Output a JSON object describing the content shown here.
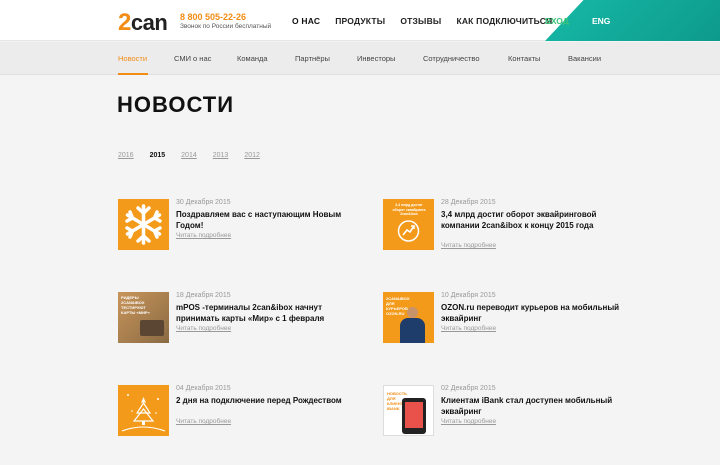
{
  "header": {
    "logo": {
      "two": "2",
      "can": "can"
    },
    "phone": "8 800 505-22-26",
    "phone_sub": "Звонок по России бесплатный",
    "nav": [
      "О НАС",
      "ПРОДУКТЫ",
      "ОТЗЫВЫ",
      "КАК ПОДКЛЮЧИТЬСЯ"
    ],
    "login": "ВХОД",
    "lang": "ENG"
  },
  "subnav": [
    "Новости",
    "СМИ о нас",
    "Команда",
    "Партнёры",
    "Инвесторы",
    "Сотрудничество",
    "Контакты",
    "Вакансии"
  ],
  "page_title": "НОВОСТИ",
  "years": [
    "2016",
    "2015",
    "2014",
    "2013",
    "2012"
  ],
  "read_more": "Читать подробнее",
  "news": [
    {
      "date": "30 Декабря 2015",
      "title": "Поздравляем вас с наступающим Новым Годом!",
      "thumb": "snowflake-icon"
    },
    {
      "date": "28 Декабря 2015",
      "title": "3,4 млрд достиг оборот эквайринговой компании 2can&ibox к концу 2015 года",
      "thumb": "growth-chart-icon",
      "thumb_text": "3,4 млрд достиг оборот эквайринга 2can&ibox"
    },
    {
      "date": "18 Декабря 2015",
      "title": "mPOS -терминалы 2can&ibox начнут принимать карты «Мир» с 1 февраля",
      "thumb": "mir-card-photo",
      "thumb_text": "РИДЕРЫ 2CAN&IBOX ТЕСТИРУЮТ КАРТЫ «МИР»"
    },
    {
      "date": "10 Декабря 2015",
      "title": "OZON.ru переводит курьеров на мобильный эквайринг",
      "thumb": "courier-photo",
      "thumb_text": "2CAN&IBOX ДЛЯ КУРЬЕРОВ OZON.RU"
    },
    {
      "date": "04 Декабря 2015",
      "title": "2 дня на подключение перед Рождеством",
      "thumb": "christmas-tree-icon"
    },
    {
      "date": "02 Декабря 2015",
      "title": "Клиентам iBank стал доступен мобильный эквайринг",
      "thumb": "ibank-phone-photo",
      "thumb_text": "НОВОСТЬ ДЛЯ КЛИЕНТОВ IBANK"
    }
  ]
}
